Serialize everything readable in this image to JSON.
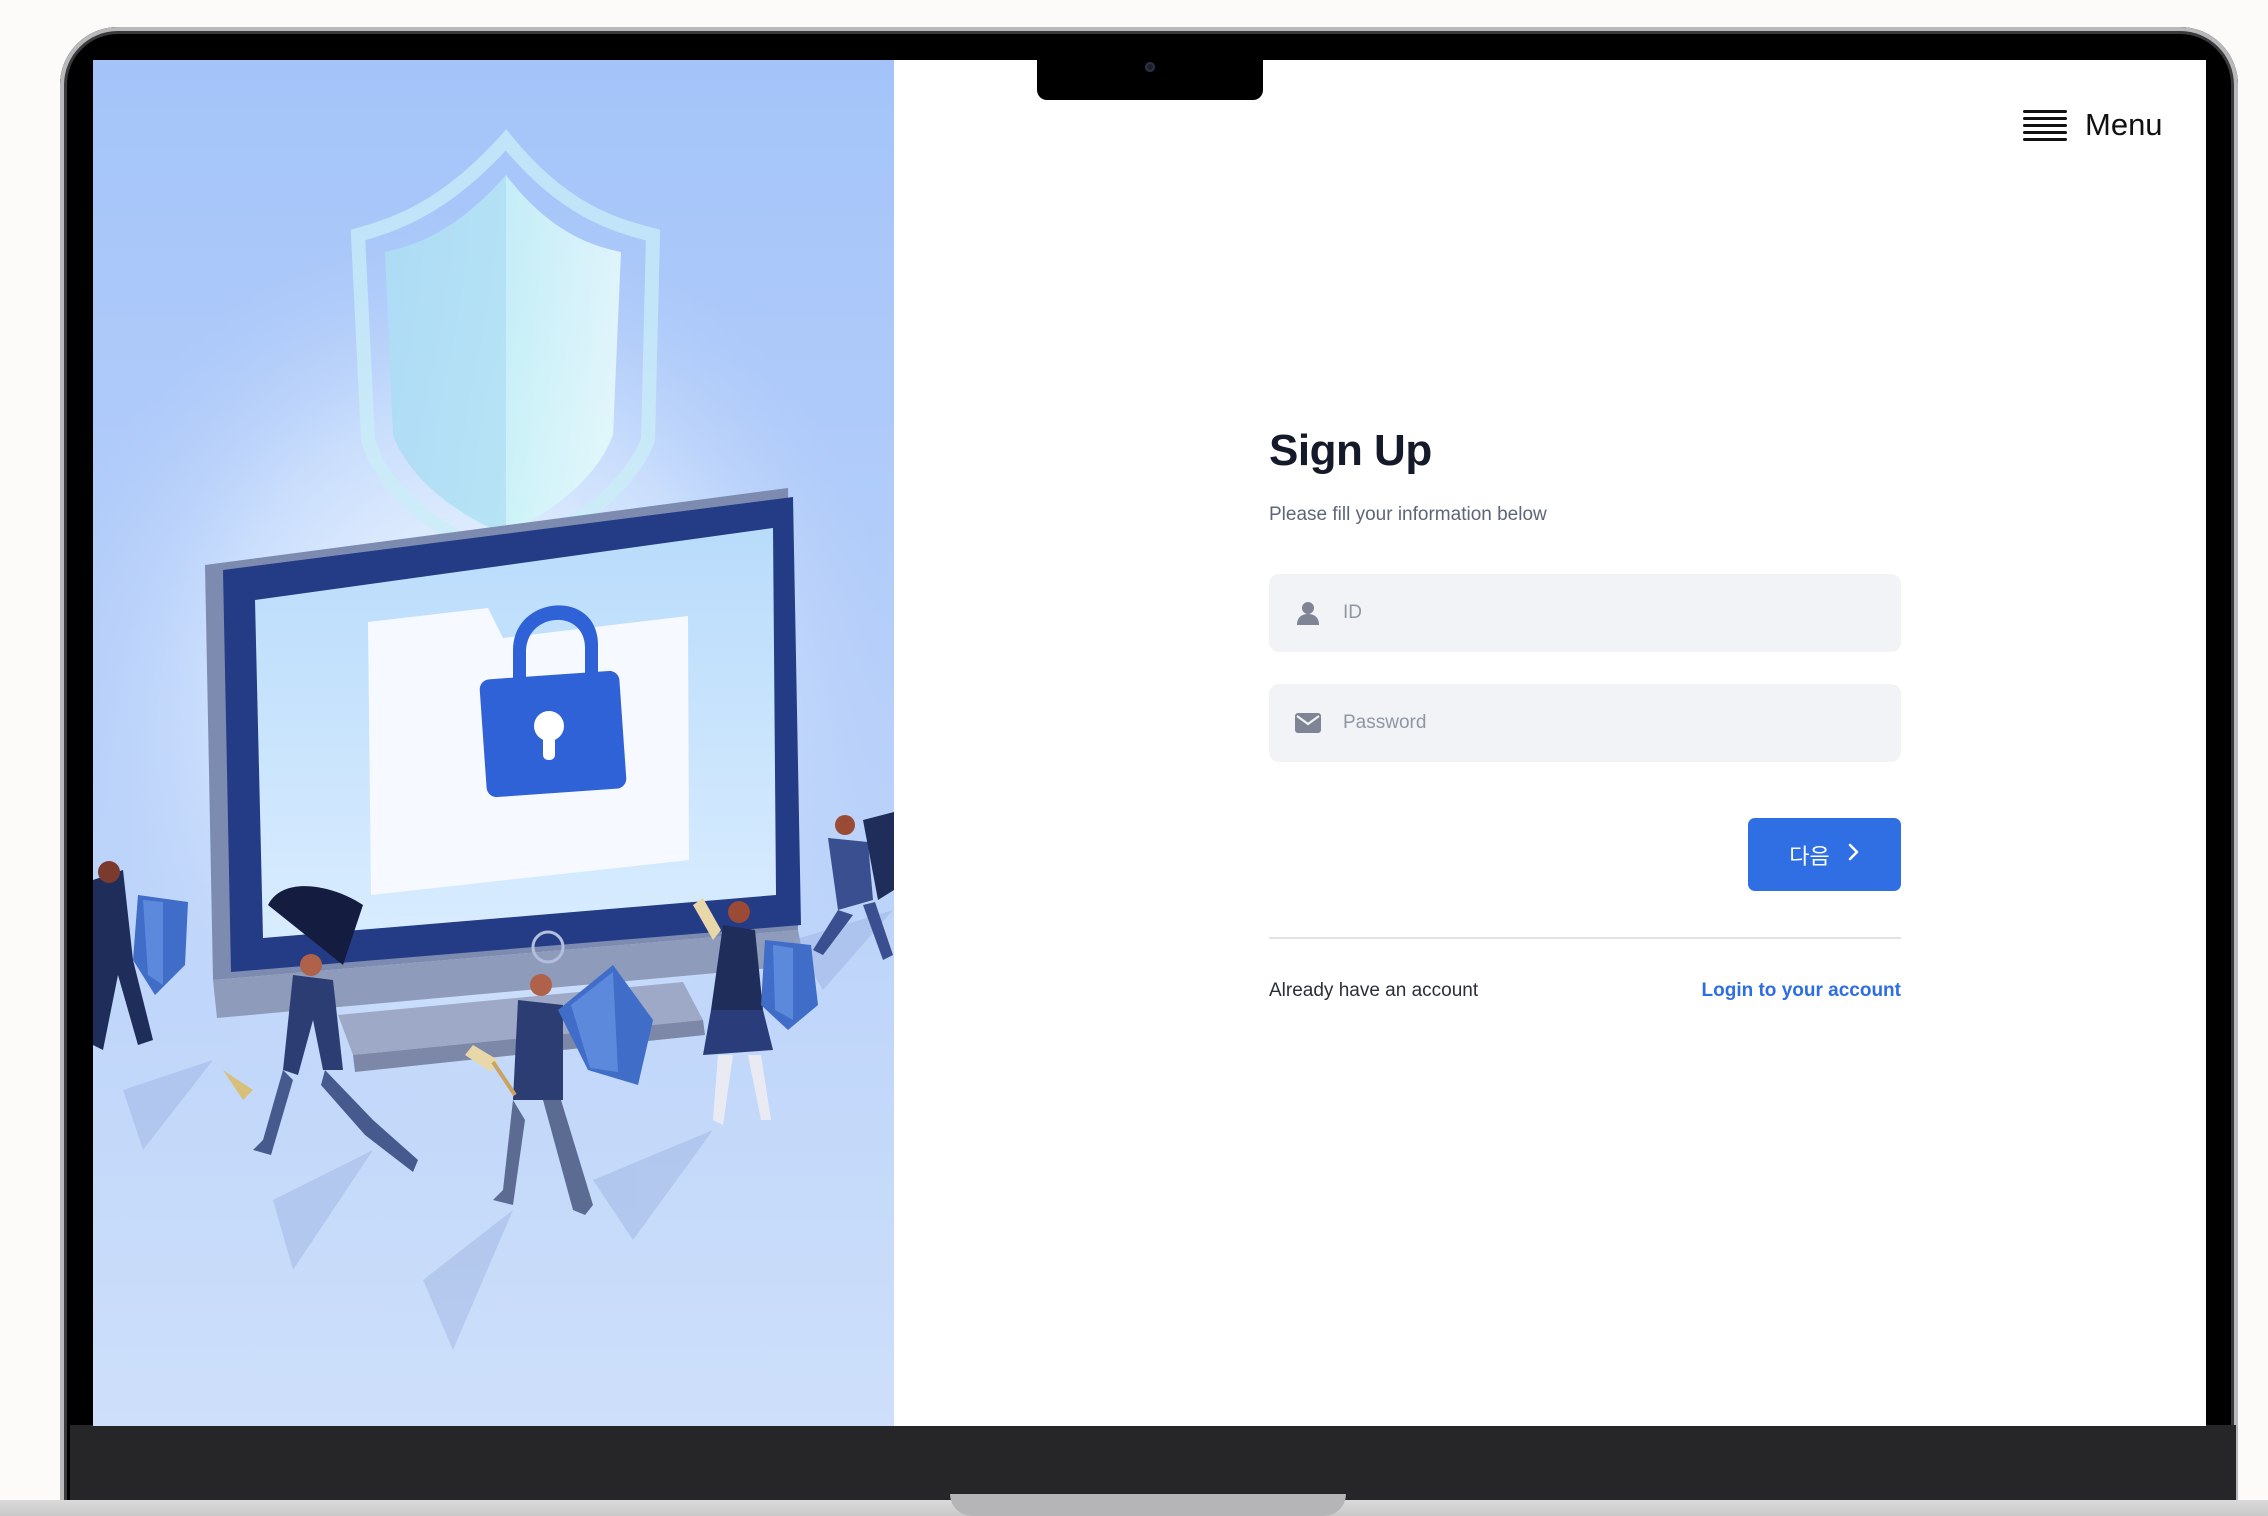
{
  "header": {
    "menu_label": "Menu"
  },
  "signup": {
    "title": "Sign Up",
    "subtitle": "Please fill your information below",
    "id_placeholder": "ID",
    "password_placeholder": "Password",
    "next_label": "다음",
    "account_prompt": "Already have an account",
    "login_link": "Login to your account"
  },
  "icons": {
    "menu": "hamburger-icon",
    "id_field": "user-icon",
    "password_field": "envelope-icon",
    "next": "chevron-right-icon",
    "illustration": [
      "shield-icon",
      "lock-icon",
      "folder-icon"
    ]
  },
  "colors": {
    "accent": "#2f6ee3",
    "link": "#2e6ee2",
    "hero_bg": "#a4c4f9",
    "field_bg": "#f2f3f6",
    "title": "#151a2a"
  }
}
